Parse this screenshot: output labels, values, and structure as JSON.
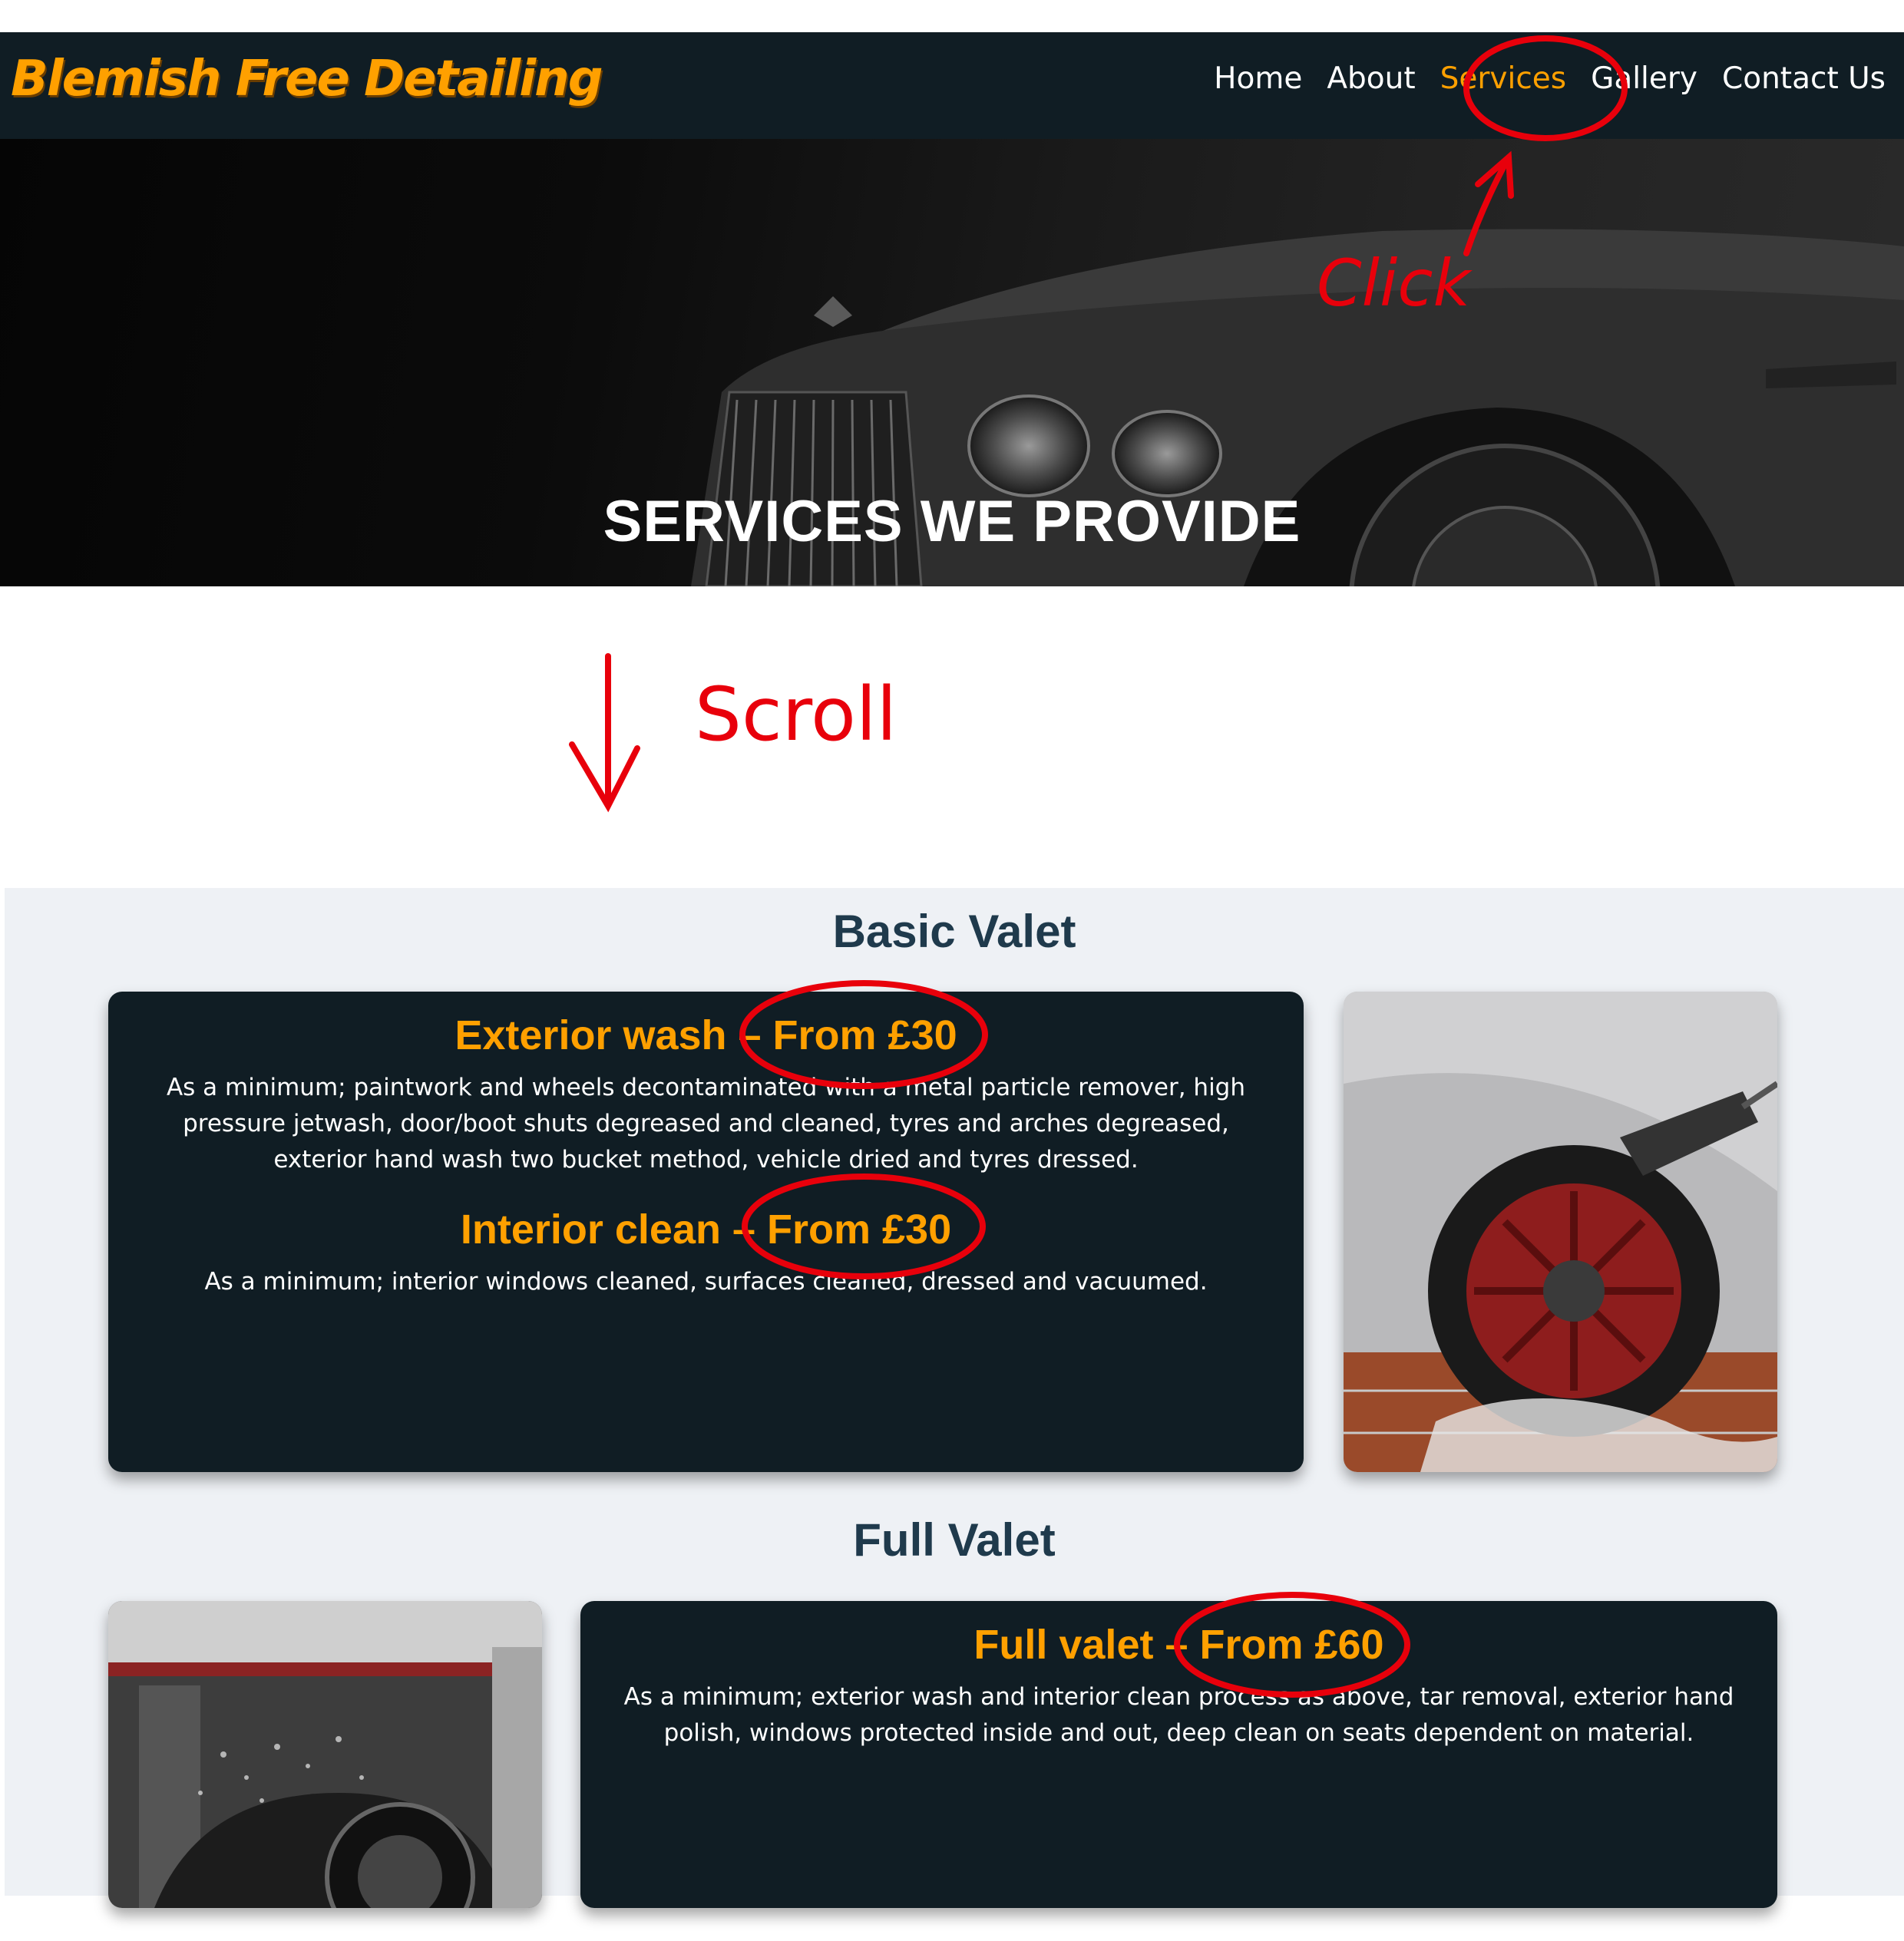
{
  "nav": {
    "brand": "Blemish Free Detailing",
    "links": [
      "Home",
      "About",
      "Services",
      "Gallery",
      "Contact Us"
    ],
    "active": "Services"
  },
  "hero": {
    "title": "SERVICES WE PROVIDE"
  },
  "annotations": {
    "click": "Click",
    "scroll": "Scroll",
    "color": "#e8000b"
  },
  "sections": {
    "basic": {
      "heading": "Basic Valet",
      "exterior_title": "Exterior wash – From £30",
      "exterior_text": "As a minimum; paintwork and wheels decontaminated with a metal particle remover, high pressure jetwash, door/boot shuts degreased and cleaned, tyres and arches degreased, exterior hand wash two bucket method, vehicle dried and tyres dressed.",
      "interior_title": "Interior clean – From £30",
      "interior_text": "As a minimum; interior windows cleaned, surfaces cleaned, dressed and vacuumed."
    },
    "full": {
      "heading": "Full Valet",
      "title": "Full valet – From £60",
      "text": "As a minimum; exterior wash and interior clean process as above, tar removal, exterior hand polish, windows protected inside and out, deep clean on seats dependent on material."
    }
  },
  "colors": {
    "accent": "#ffa000",
    "nav_bg": "#101d24",
    "card_bg": "#101d24",
    "heading": "#1f3a4c",
    "section_bg": "#eef1f5"
  }
}
